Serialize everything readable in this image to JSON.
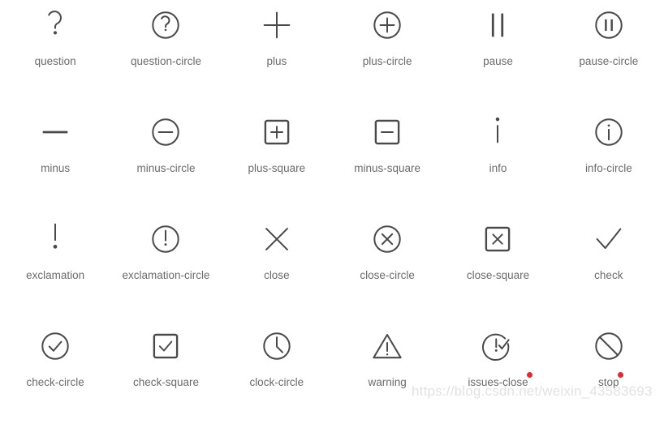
{
  "page": {
    "title": "Ant Design Icon Set — Suggested Icons",
    "background_color": "#ffffff",
    "icon_color": "#4a4a4a",
    "label_color": "#6b6b6b",
    "badge_color": "#e8272c",
    "columns": 6,
    "rows": 4
  },
  "watermark": {
    "text": "https://blog.csdn.net/weixin_43583693",
    "color": "#e2e2e4"
  },
  "icons": [
    {
      "name": "question",
      "label": "question",
      "shape": "question",
      "badge": false
    },
    {
      "name": "question-circle",
      "label": "question-circle",
      "shape": "question-circle",
      "badge": false
    },
    {
      "name": "plus",
      "label": "plus",
      "shape": "plus",
      "badge": false
    },
    {
      "name": "plus-circle",
      "label": "plus-circle",
      "shape": "plus-circle",
      "badge": false
    },
    {
      "name": "pause",
      "label": "pause",
      "shape": "pause",
      "badge": false
    },
    {
      "name": "pause-circle",
      "label": "pause-circle",
      "shape": "pause-circle",
      "badge": false
    },
    {
      "name": "minus",
      "label": "minus",
      "shape": "minus",
      "badge": false
    },
    {
      "name": "minus-circle",
      "label": "minus-circle",
      "shape": "minus-circle",
      "badge": false
    },
    {
      "name": "plus-square",
      "label": "plus-square",
      "shape": "plus-square",
      "badge": false
    },
    {
      "name": "minus-square",
      "label": "minus-square",
      "shape": "minus-square",
      "badge": false
    },
    {
      "name": "info",
      "label": "info",
      "shape": "info",
      "badge": false
    },
    {
      "name": "info-circle",
      "label": "info-circle",
      "shape": "info-circle",
      "badge": false
    },
    {
      "name": "exclamation",
      "label": "exclamation",
      "shape": "exclamation",
      "badge": false
    },
    {
      "name": "exclamation-circle",
      "label": "exclamation-circle",
      "shape": "exclamation-circle",
      "badge": false
    },
    {
      "name": "close",
      "label": "close",
      "shape": "close",
      "badge": false
    },
    {
      "name": "close-circle",
      "label": "close-circle",
      "shape": "close-circle",
      "badge": false
    },
    {
      "name": "close-square",
      "label": "close-square",
      "shape": "close-square",
      "badge": false
    },
    {
      "name": "check",
      "label": "check",
      "shape": "check",
      "badge": false
    },
    {
      "name": "check-circle",
      "label": "check-circle",
      "shape": "check-circle",
      "badge": false
    },
    {
      "name": "check-square",
      "label": "check-square",
      "shape": "check-square",
      "badge": false
    },
    {
      "name": "clock-circle",
      "label": "clock-circle",
      "shape": "clock-circle",
      "badge": false
    },
    {
      "name": "warning",
      "label": "warning",
      "shape": "warning",
      "badge": false
    },
    {
      "name": "issues-close",
      "label": "issues-close",
      "shape": "issues-close",
      "badge": true
    },
    {
      "name": "stop",
      "label": "stop",
      "shape": "stop",
      "badge": true
    }
  ]
}
